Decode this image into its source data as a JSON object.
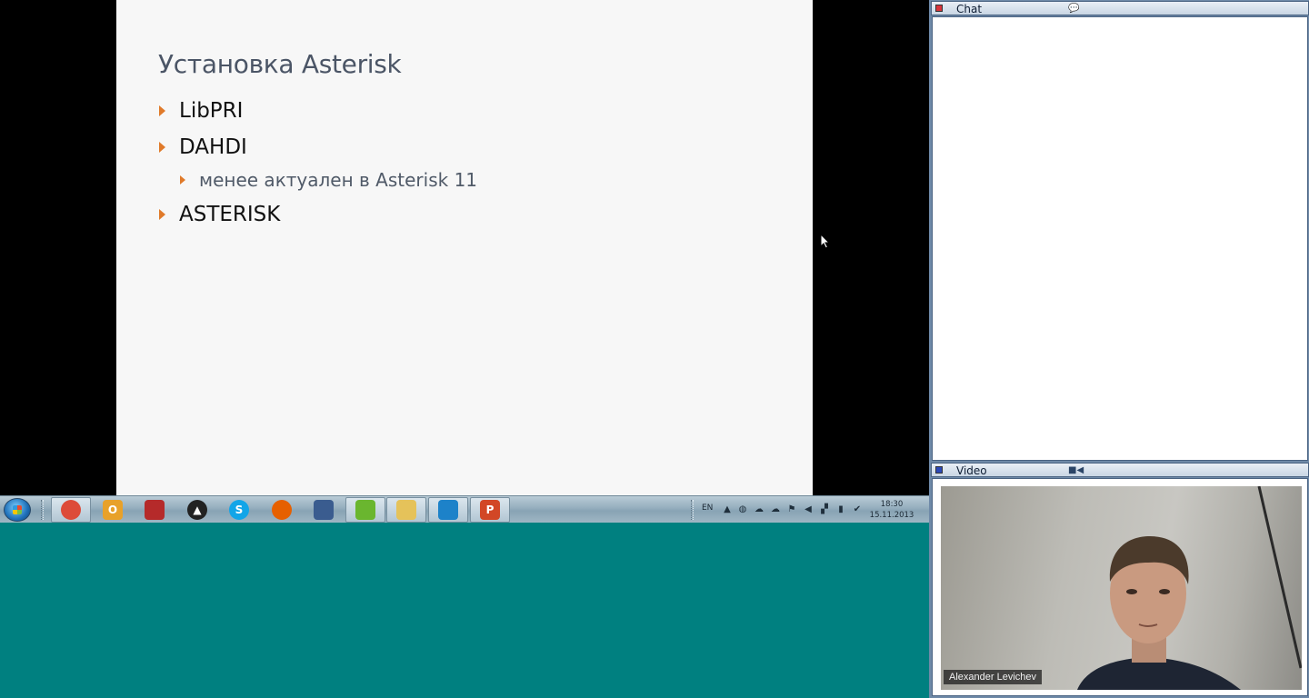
{
  "slide": {
    "title": "Установка Asterisk",
    "bullets": [
      {
        "text": "LibPRI",
        "level": 1
      },
      {
        "text": "DAHDI",
        "level": 1
      },
      {
        "text": "менее актуален в Asterisk 11",
        "level": 2
      },
      {
        "text": "ASTERISK",
        "level": 1
      }
    ],
    "bullet_color": "#e07a2a"
  },
  "taskbar": {
    "apps": [
      {
        "name": "chrome-icon",
        "glyph": "",
        "color": "#dd4b39"
      },
      {
        "name": "outlook-icon",
        "glyph": "O",
        "color": "#e8a12a"
      },
      {
        "name": "books-icon",
        "glyph": "",
        "color": "#b52a2a"
      },
      {
        "name": "archicad-icon",
        "glyph": "▲",
        "color": "#222222"
      },
      {
        "name": "skype-icon",
        "glyph": "S",
        "color": "#12a5e8"
      },
      {
        "name": "firefox-icon",
        "glyph": "",
        "color": "#e66000"
      },
      {
        "name": "network-icon",
        "glyph": "",
        "color": "#3a5c8f"
      },
      {
        "name": "vmware-icon",
        "glyph": "",
        "color": "#6ab62f"
      },
      {
        "name": "explorer-icon",
        "glyph": "",
        "color": "#e5c25a"
      },
      {
        "name": "outlook-mail-icon",
        "glyph": "",
        "color": "#1d82c9"
      },
      {
        "name": "powerpoint-icon",
        "glyph": "P",
        "color": "#d24726"
      }
    ],
    "language": "EN",
    "time": "18:30",
    "date": "15.11.2013"
  },
  "chat": {
    "title": "Chat",
    "dot_color": "#d9343b"
  },
  "video": {
    "title": "Video",
    "dot_color": "#2c49b8",
    "participant_name": "Alexander Levichev"
  },
  "colors": {
    "desktop": "#008080",
    "panel_border": "#4a6382"
  }
}
